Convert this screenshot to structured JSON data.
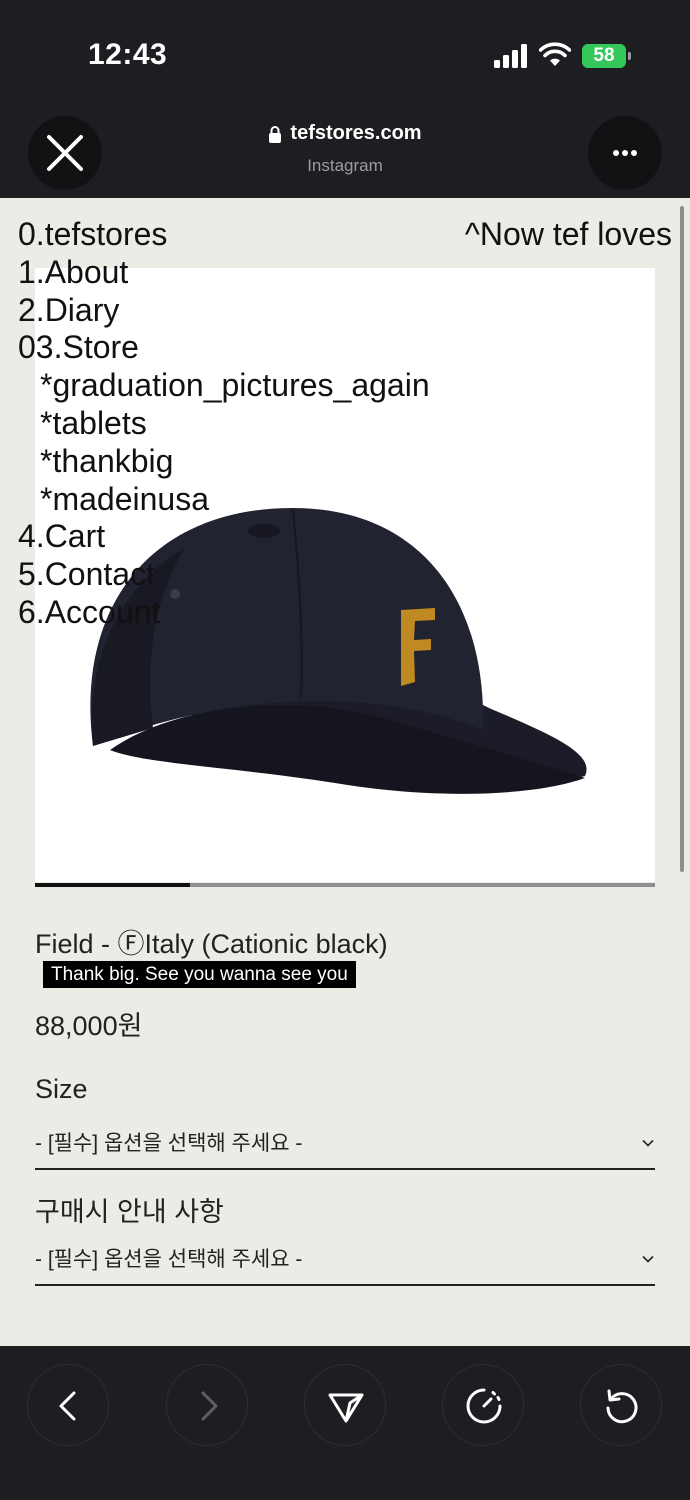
{
  "status_bar": {
    "time": "12:43",
    "battery": "58"
  },
  "browser": {
    "domain": "tefstores.com",
    "source": "Instagram"
  },
  "nav": {
    "items": [
      {
        "label": "0.tefstores"
      },
      {
        "label": "1.About"
      },
      {
        "label": "2.Diary"
      },
      {
        "label": "03.Store"
      },
      {
        "label": "*graduation_pictures_again"
      },
      {
        "label": "*tablets"
      },
      {
        "label": "*thankbig"
      },
      {
        "label": "*madeinusa"
      },
      {
        "label": "4.Cart"
      },
      {
        "label": "5.Contact"
      },
      {
        "label": "6.Account"
      }
    ],
    "right_label": "^Now tef loves"
  },
  "gallery": {
    "image": "black-baseball-cap-with-gold-F-logo",
    "progress_fraction": 0.25
  },
  "product": {
    "name": "Field - ⒻItaly (Cationic black)",
    "promo": "Thank big. See you wanna see you",
    "price": "88,000원"
  },
  "options": [
    {
      "label": "Size",
      "placeholder": "- [필수] 옵션을 선택해 주세요 -"
    },
    {
      "label": "구매시 안내 사항",
      "placeholder": "- [필수] 옵션을 선택해 주세요 -"
    }
  ],
  "toolbar": {
    "buttons": [
      "back-icon",
      "forward-icon",
      "share-icon",
      "speed-icon",
      "refresh-icon"
    ]
  },
  "colors": {
    "page_bg": "#ecebe5",
    "chrome_bg": "#1c1e21",
    "battery": "#34c759",
    "logo_gold": "#c08a22"
  }
}
